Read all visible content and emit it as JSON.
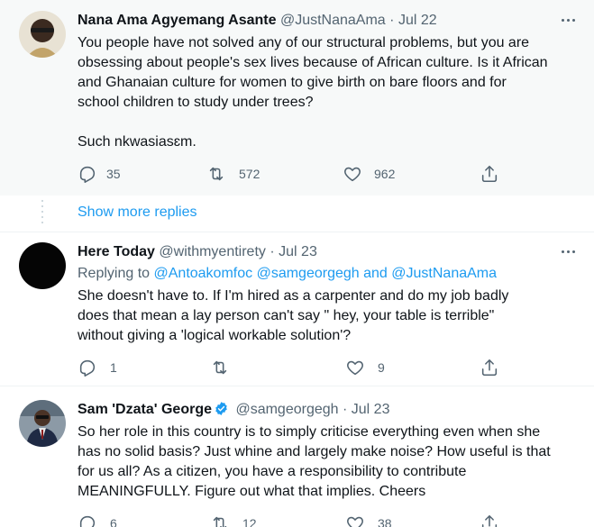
{
  "tweets": [
    {
      "name": "Nana Ama Agyemang Asante",
      "handle": "@JustNanaAma",
      "separator": "·",
      "date": "Jul 22",
      "text_lines": [
        "You people have not solved any of our structural problems, but you are",
        "obsessing about people's sex lives because of African culture. Is it African",
        "and Ghanaian culture for women to give birth on bare floors and for",
        "school children to study under trees?",
        "",
        "Such nkwasiasɛm."
      ],
      "replies": "35",
      "retweets": "572",
      "likes": "962"
    },
    {
      "name": "Here Today",
      "handle": "@withmyentirety",
      "separator": "·",
      "date": "Jul 23",
      "replying_prefix": "Replying to",
      "replying_mentions": [
        "@Antoakomfoc",
        "@samgeorgegh",
        "@JustNanaAma"
      ],
      "replying_and": "and",
      "text_lines": [
        "She doesn't have to. If I'm hired as a carpenter and do my job badly",
        "does that mean a lay person can't say \" hey, your table is terrible\"",
        "without giving a 'logical workable solution'?"
      ],
      "replies": "1",
      "retweets": "",
      "likes": "9"
    },
    {
      "name": "Sam 'Dzata' George",
      "handle": "@samgeorgegh",
      "separator": "·",
      "date": "Jul 23",
      "verified": true,
      "text_lines": [
        "So her role in this country is to simply criticise everything even when she",
        "has no solid basis? Just whine and largely make noise? How useful is that",
        "for us all? As a citizen, you have a responsibility to contribute",
        "MEANINGFULLY. Figure out what that implies. Cheers"
      ],
      "replies": "6",
      "retweets": "12",
      "likes": "38"
    }
  ],
  "show_more_replies": "Show more replies",
  "icons": {
    "reply": "reply-icon",
    "retweet": "retweet-icon",
    "like": "heart-icon",
    "share": "share-icon",
    "more": "more-icon",
    "verified": "verified-badge-icon"
  },
  "colors": {
    "link": "#1d9bf0",
    "secondary_text": "#536471",
    "primary_text": "#0f1419",
    "highlight_background": "#f7f9f9"
  }
}
